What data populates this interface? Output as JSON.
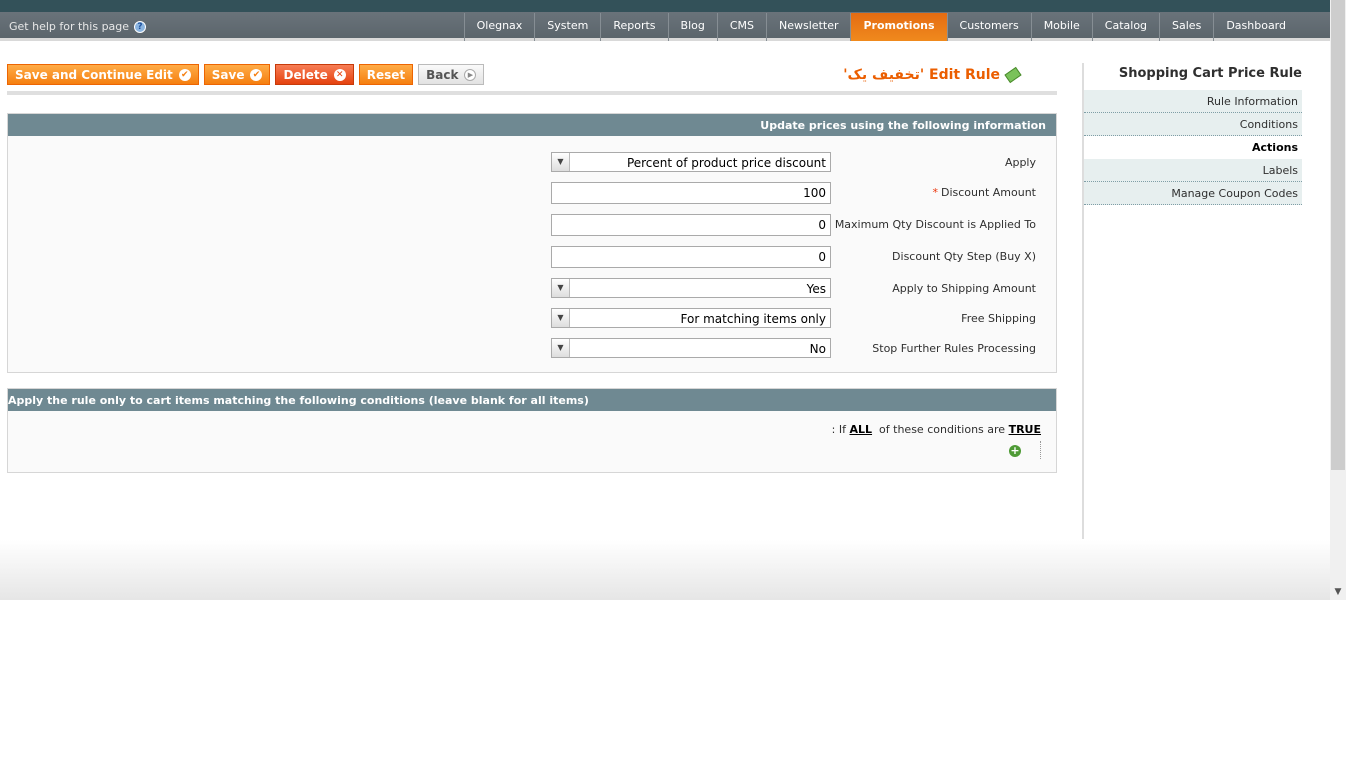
{
  "help": {
    "label": "Get help for this page",
    "icon": "help-icon"
  },
  "menu": [
    {
      "label": "Dashboard"
    },
    {
      "label": "Sales"
    },
    {
      "label": "Catalog"
    },
    {
      "label": "Mobile"
    },
    {
      "label": "Customers"
    },
    {
      "label": "Promotions",
      "active": true
    },
    {
      "label": "Newsletter"
    },
    {
      "label": "CMS"
    },
    {
      "label": "Blog"
    },
    {
      "label": "Reports"
    },
    {
      "label": "System"
    },
    {
      "label": "Olegnax"
    }
  ],
  "toolbar": {
    "save_continue": "Save and Continue Edit",
    "save": "Save",
    "delete": "Delete",
    "reset": "Reset",
    "back": "Back"
  },
  "page_title": "Edit Rule 'تخفیف یک'",
  "actions": {
    "header": "Update prices using the following information",
    "apply_label": "Apply",
    "apply_value": "Percent of product price discount",
    "discount_label": "Discount Amount",
    "discount_value": "100",
    "maxqty_label": "Maximum Qty Discount is Applied To",
    "maxqty_value": "0",
    "step_label": "Discount Qty Step (Buy X)",
    "step_value": "0",
    "shipping_label": "Apply to Shipping Amount",
    "shipping_value": "Yes",
    "free_label": "Free Shipping",
    "free_value": "For matching items only",
    "stop_label": "Stop Further Rules Processing",
    "stop_value": "No"
  },
  "conditions": {
    "header": "Apply the rule only to cart items matching the following conditions (leave blank for all items)",
    "prefix": ": If",
    "all": "ALL",
    "middle": "of these conditions are",
    "true": "TRUE"
  },
  "sidebar": {
    "title": "Shopping Cart Price Rule",
    "tabs": [
      {
        "label": "Rule Information"
      },
      {
        "label": "Conditions"
      },
      {
        "label": "Actions",
        "active": true
      },
      {
        "label": "Labels"
      },
      {
        "label": "Manage Coupon Codes"
      }
    ]
  },
  "colors": {
    "accent": "#eb5e00",
    "header": "#6f8992",
    "nav": "#5b656c"
  }
}
